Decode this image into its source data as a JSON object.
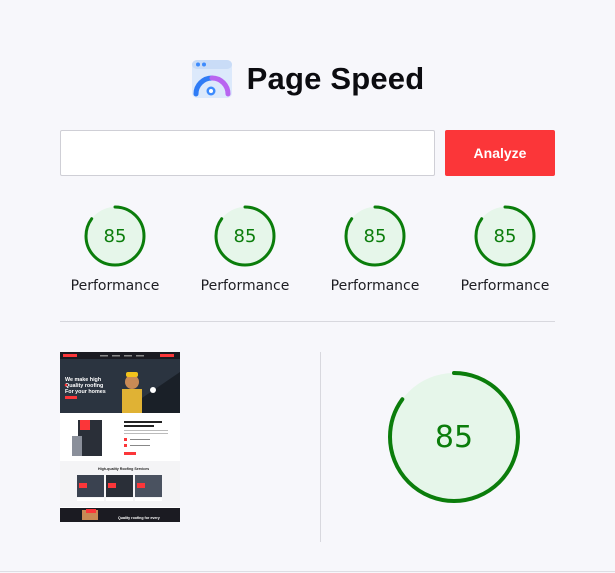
{
  "header": {
    "title": "Page Speed",
    "logo_icon": "speedometer-window-icon"
  },
  "search": {
    "value": "",
    "placeholder": "",
    "button_label": "Analyze"
  },
  "scores": [
    {
      "value": "85",
      "fraction": 0.85,
      "label": "Performance"
    },
    {
      "value": "85",
      "fraction": 0.85,
      "label": "Performance"
    },
    {
      "value": "85",
      "fraction": 0.85,
      "label": "Performance"
    },
    {
      "value": "85",
      "fraction": 0.85,
      "label": "Performance"
    }
  ],
  "preview": {
    "hero_line1": "We make high",
    "hero_line2": "Quality roofing",
    "hero_line3": "For your homes",
    "services_heading": "High-quality Roofing Services",
    "footer_heading": "Quality roofing for every"
  },
  "overall": {
    "value": "85",
    "fraction": 0.85
  },
  "colors": {
    "accent": "#fb3639",
    "score_green": "#0b7d0b",
    "score_fill": "#e6f6ea"
  }
}
